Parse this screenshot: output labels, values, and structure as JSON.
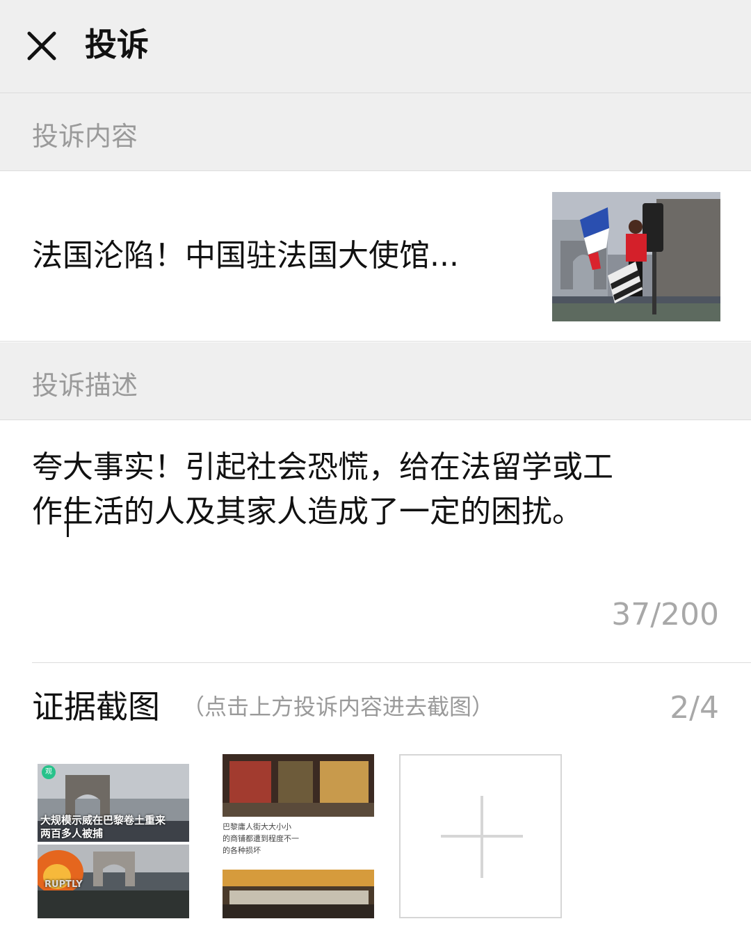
{
  "header": {
    "title": "投诉",
    "close_icon": "close-icon"
  },
  "sections": {
    "content_label": "投诉内容",
    "description_label": "投诉描述"
  },
  "content": {
    "title": "法国沦陷！中国驻法国大使馆..."
  },
  "description": {
    "line1": "夸大事实！引起社会恐慌，给在法留学或工",
    "line2": "作生活的人及其家人造成了一定的困扰。",
    "counter": "37/200"
  },
  "evidence": {
    "title": "证据截图",
    "hint": "（点击上方投诉内容进去截图）",
    "count": "2/4",
    "shot1": {
      "badge": "观",
      "caption_line1": "大规模示威在巴黎卷土重来",
      "caption_line2": "两百多人被捕",
      "watermark": "RUPTLY"
    },
    "shot2": {
      "text_line1": "巴黎庸人街大大小小",
      "text_line2": "的商铺都遭到程度不一",
      "text_line3": "的各种损坏"
    },
    "add_icon": "plus-icon"
  }
}
